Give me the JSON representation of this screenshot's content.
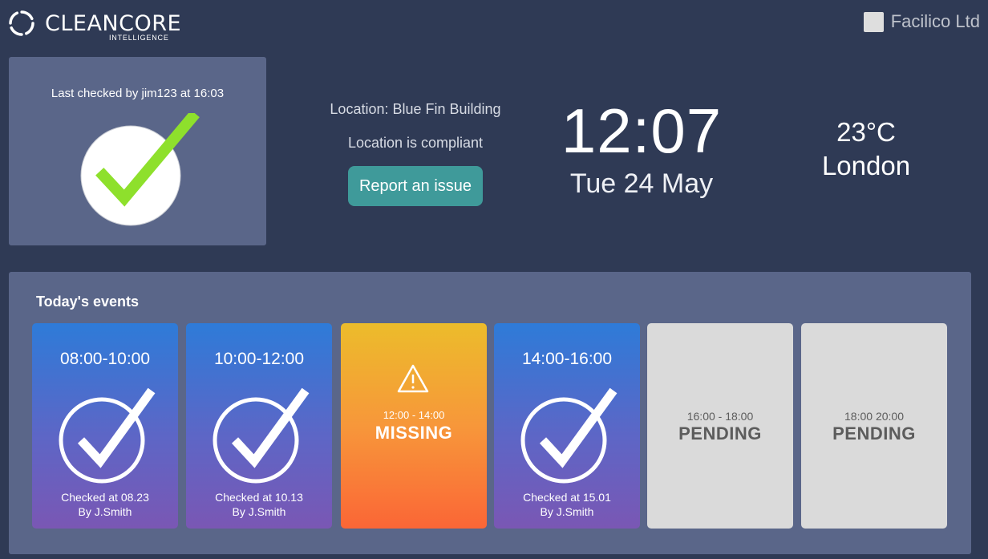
{
  "header": {
    "logo_name": "CLEANCORE",
    "logo_sub": "INTELLIGENCE",
    "company": "Facilico Ltd"
  },
  "status": {
    "last_checked": "Last checked by jim123 at 16:03",
    "icon": "big-check-icon",
    "check_color": "#8ee02c"
  },
  "location": {
    "name": "Location: Blue Fin Building",
    "status": "Location is compliant",
    "report_label": "Report an issue",
    "button_color": "#3f9a9a"
  },
  "clock": {
    "time": "12:07",
    "date": "Tue 24 May"
  },
  "weather": {
    "temperature": "23°C",
    "city": "London"
  },
  "events": {
    "title": "Today's events",
    "items": [
      {
        "time": "08:00-10:00",
        "state": "done",
        "checked": "Checked at 08.23",
        "by": "By J.Smith"
      },
      {
        "time": "10:00-12:00",
        "state": "done",
        "checked": "Checked at 10.13",
        "by": "By J.Smith"
      },
      {
        "time": "12:00 - 14:00",
        "state": "missing",
        "label": "MISSING"
      },
      {
        "time": "14:00-16:00",
        "state": "done",
        "checked": "Checked at 15.01",
        "by": "By J.Smith"
      },
      {
        "time": "16:00 - 18:00",
        "state": "pending",
        "label": "PENDING"
      },
      {
        "time": "18:00 20:00",
        "state": "pending",
        "label": "PENDING"
      }
    ]
  }
}
